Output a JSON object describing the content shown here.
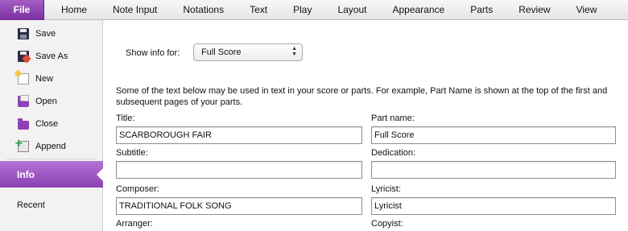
{
  "ribbon": {
    "file_tab": "File",
    "tabs": [
      "Home",
      "Note Input",
      "Notations",
      "Text",
      "Play",
      "Layout",
      "Appearance",
      "Parts",
      "Review",
      "View"
    ]
  },
  "sidebar": {
    "items": [
      {
        "label": "Save",
        "icon": "save-icon"
      },
      {
        "label": "Save As",
        "icon": "save-as-icon"
      },
      {
        "label": "New",
        "icon": "new-document-icon"
      },
      {
        "label": "Open",
        "icon": "open-folder-icon"
      },
      {
        "label": "Close",
        "icon": "close-folder-icon"
      },
      {
        "label": "Append",
        "icon": "append-icon"
      }
    ],
    "selected": "Info",
    "recent": "Recent"
  },
  "show_info": {
    "label": "Show info for:",
    "selected": "Full Score"
  },
  "description": "Some of the text below may be used in text in your score or parts. For example, Part Name is shown at the top of the first and subsequent pages of your parts.",
  "fields": {
    "title": {
      "label": "Title:",
      "value": "SCARBOROUGH FAIR"
    },
    "part_name": {
      "label": "Part name:",
      "value": "Full Score"
    },
    "subtitle": {
      "label": "Subtitle:",
      "value": ""
    },
    "dedication": {
      "label": "Dedication:",
      "value": ""
    },
    "composer": {
      "label": "Composer:",
      "value": "TRADITIONAL FOLK SONG"
    },
    "lyricist": {
      "label": "Lyricist:",
      "value": "Lyricist"
    },
    "arranger": {
      "label": "Arranger:"
    },
    "copyist": {
      "label": "Copyist:"
    }
  },
  "colors": {
    "accent": "#8b3fb3",
    "file_tab": "#7b2e9f"
  }
}
